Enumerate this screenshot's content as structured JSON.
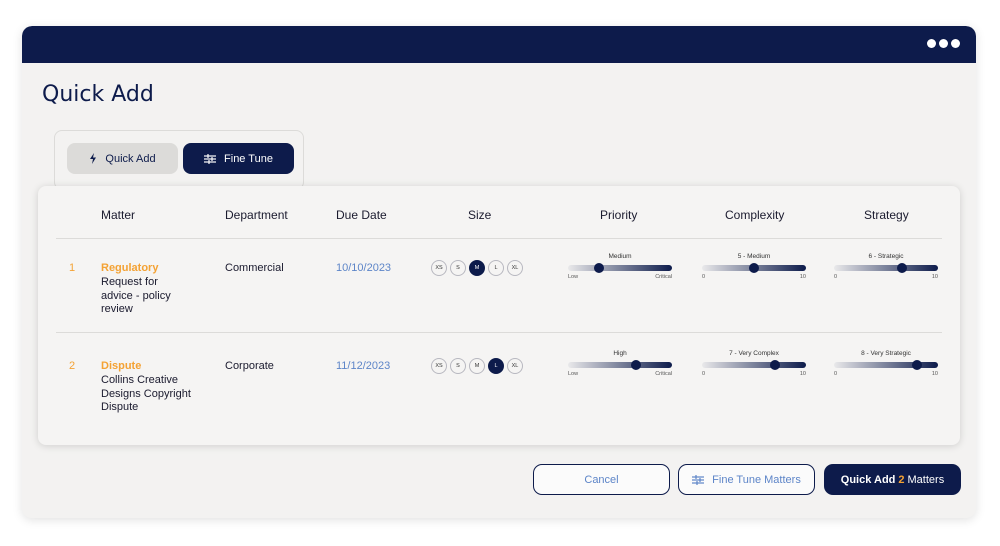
{
  "page": {
    "title": "Quick Add"
  },
  "toggle": {
    "quick_add_label": "Quick Add",
    "fine_tune_label": "Fine Tune"
  },
  "table": {
    "headers": [
      "Matter",
      "Department",
      "Due Date",
      "Size",
      "Priority",
      "Complexity",
      "Strategy"
    ],
    "sizes": [
      "XS",
      "S",
      "M",
      "L",
      "XL"
    ],
    "rows": [
      {
        "num": "1",
        "matter_title": "Regulatory",
        "matter_desc": "Request for advice - policy review",
        "department": "Commercial",
        "due_date": "10/10/2023",
        "selected_size": "M",
        "priority": {
          "label": "Medium",
          "min": "Low",
          "max": "Critical",
          "fraction": 0.3
        },
        "complexity": {
          "label": "5 - Medium",
          "min": "0",
          "max": "10",
          "fraction": 0.5
        },
        "strategy": {
          "label": "6 - Strategic",
          "min": "0",
          "max": "10",
          "fraction": 0.65
        }
      },
      {
        "num": "2",
        "matter_title": "Dispute",
        "matter_desc": "Collins Creative Designs Copyright Dispute",
        "department": "Corporate",
        "due_date": "11/12/2023",
        "selected_size": "L",
        "priority": {
          "label": "High",
          "min": "Low",
          "max": "Critical",
          "fraction": 0.65
        },
        "complexity": {
          "label": "7 - Very Complex",
          "min": "0",
          "max": "10",
          "fraction": 0.7
        },
        "strategy": {
          "label": "8 - Very Strategic",
          "min": "0",
          "max": "10",
          "fraction": 0.8
        }
      }
    ]
  },
  "actions": {
    "cancel_label": "Cancel",
    "fine_tune_label": "Fine Tune Matters",
    "quick_add_prefix": "Quick Add",
    "quick_add_count": "2",
    "quick_add_suffix": "Matters"
  },
  "colors": {
    "navy": "#0d1b4b",
    "accent": "#f4a234",
    "link": "#5d85c8",
    "background": "#f3f2f1"
  },
  "icons": {
    "quick_add": "lightning-icon",
    "fine_tune": "sliders-icon",
    "menu": "more-dots-icon"
  }
}
